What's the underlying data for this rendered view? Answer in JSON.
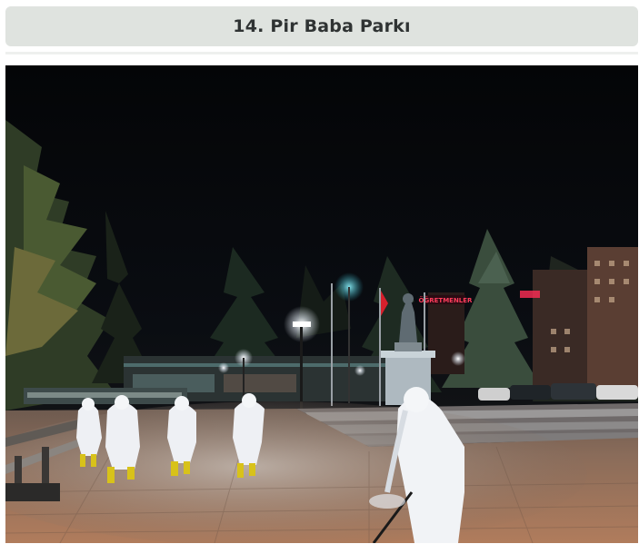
{
  "page": {
    "title": "14. Pir Baba Parkı"
  },
  "photo": {
    "description_icon": "park-night-photo",
    "sign_text": "ÖĞRETMENLER"
  },
  "colors": {
    "title_bg": "#dfe3df",
    "title_text": "#2f3333",
    "sky": "#06080b",
    "suit": "#eef0f4",
    "boots": "#d8c21a",
    "pavement": "#a4765a"
  }
}
